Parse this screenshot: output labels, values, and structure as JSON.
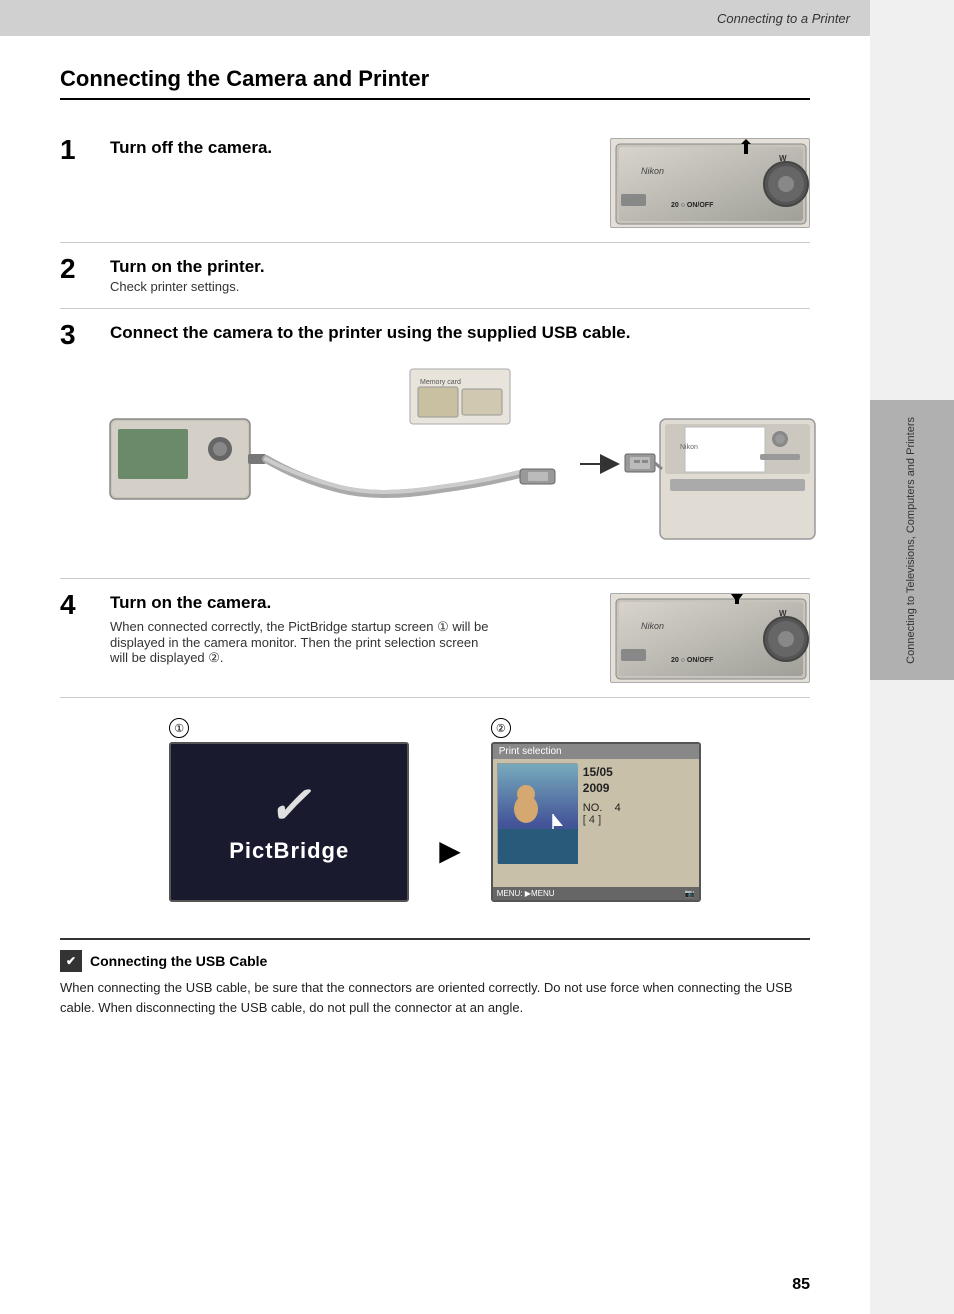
{
  "header": {
    "title": "Connecting to a Printer"
  },
  "page": {
    "main_heading": "Connecting the Camera and Printer"
  },
  "steps": [
    {
      "number": "1",
      "main_text": "Turn off the camera.",
      "sub_text": ""
    },
    {
      "number": "2",
      "main_text": "Turn on the printer.",
      "sub_text": "Check printer settings."
    },
    {
      "number": "3",
      "main_text": "Connect the camera to the printer using the supplied USB cable.",
      "sub_text": ""
    },
    {
      "number": "4",
      "main_text": "Turn on the camera.",
      "sub_text": "When connected correctly, the PictBridge startup screen ① will be displayed in the camera monitor. Then the print selection screen will be displayed ②."
    }
  ],
  "screens": {
    "circle1": "①",
    "circle2": "②",
    "pictbridge_label": "PictBridge",
    "print_selection_header": "Print selection",
    "print_date_line1": "15/05",
    "print_date_line2": "2009",
    "print_no_label": "NO.",
    "print_no_value": "4",
    "print_no_count": "4",
    "menu_label": "MENU",
    "arrow": "▶"
  },
  "note": {
    "icon": "✔",
    "title": "Connecting the USB Cable",
    "text": "When connecting the USB cable, be sure that the connectors are oriented correctly. Do not use force when connecting the USB cable. When disconnecting the USB cable, do not pull the connector at an angle."
  },
  "sidebar": {
    "text": "Connecting to Televisions, Computers and Printers"
  },
  "page_number": "85"
}
